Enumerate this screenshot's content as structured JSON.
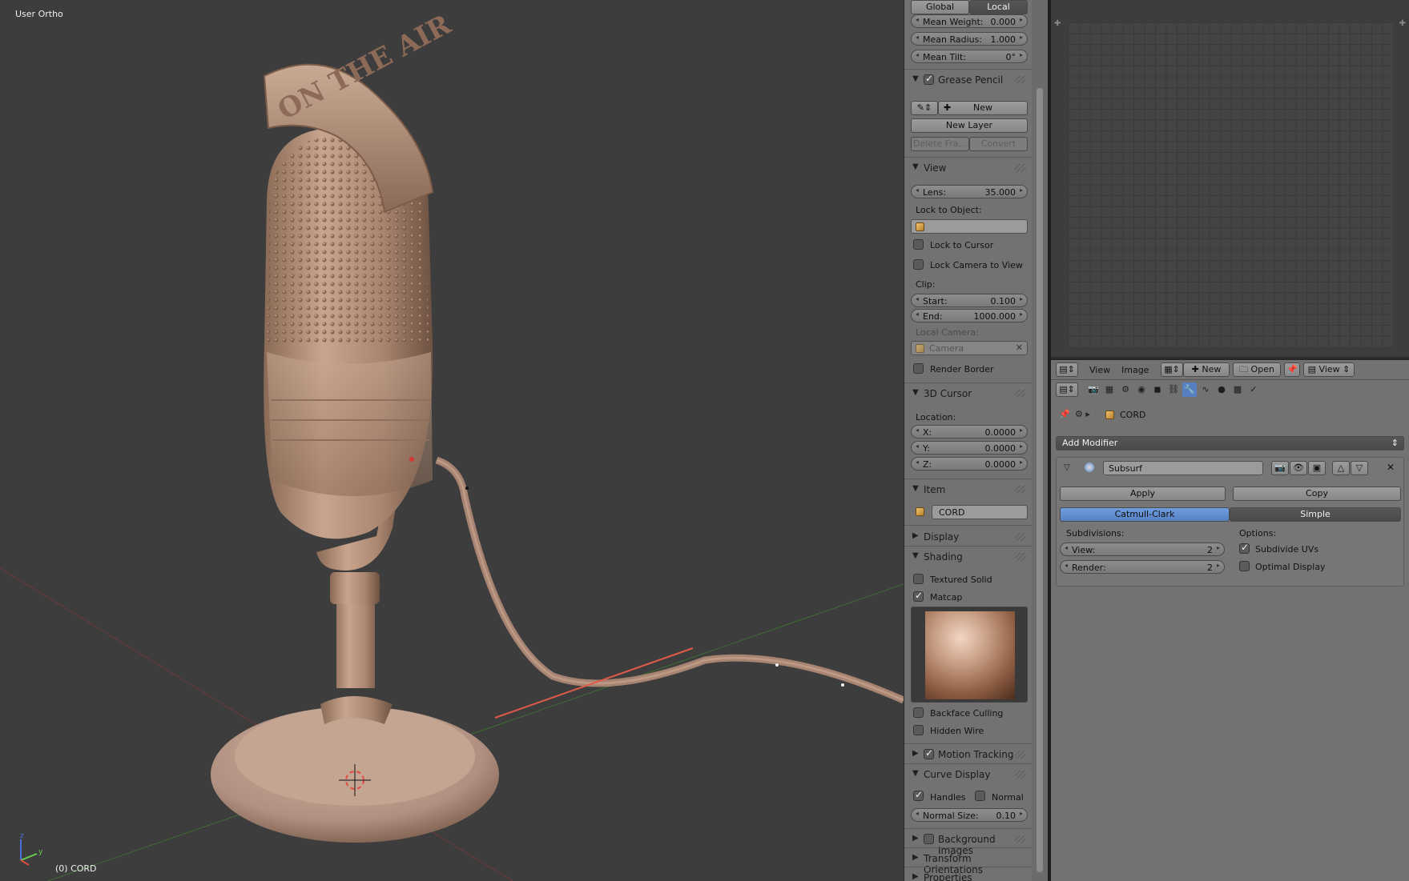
{
  "viewport": {
    "view_label": "User Ortho",
    "object_label": "(0) CORD",
    "overlay_text": "ON THE AIR"
  },
  "npanel": {
    "coord_tabs": [
      "Global",
      "Local"
    ],
    "mean_weight": {
      "label": "Mean Weight:",
      "value": "0.000"
    },
    "mean_radius": {
      "label": "Mean Radius:",
      "value": "1.000"
    },
    "mean_tilt": {
      "label": "Mean Tilt:",
      "value": "0°"
    },
    "grease_pencil": {
      "title": "Grease Pencil",
      "new": "New",
      "new_layer": "New Layer",
      "delete_frame": "Delete Fra...",
      "convert": "Convert"
    },
    "view": {
      "title": "View",
      "lens": {
        "label": "Lens:",
        "value": "35.000"
      },
      "lock_to_object": "Lock to Object:",
      "lock_to_cursor": "Lock to Cursor",
      "lock_camera": "Lock Camera to View",
      "clip": "Clip:",
      "clip_start": {
        "label": "Start:",
        "value": "0.100"
      },
      "clip_end": {
        "label": "End:",
        "value": "1000.000"
      },
      "local_camera": "Local Camera:",
      "camera": "Camera",
      "render_border": "Render Border"
    },
    "cursor": {
      "title": "3D Cursor",
      "location": "Location:",
      "x": {
        "label": "X:",
        "value": "0.0000"
      },
      "y": {
        "label": "Y:",
        "value": "0.0000"
      },
      "z": {
        "label": "Z:",
        "value": "0.0000"
      }
    },
    "item": {
      "title": "Item",
      "name": "CORD"
    },
    "display": {
      "title": "Display"
    },
    "shading": {
      "title": "Shading",
      "textured_solid": "Textured Solid",
      "matcap": "Matcap",
      "backface": "Backface Culling",
      "hidden_wire": "Hidden Wire"
    },
    "motion_tracking": {
      "title": "Motion Tracking"
    },
    "curve_display": {
      "title": "Curve Display",
      "handles": "Handles",
      "normal": "Normal",
      "normal_size": {
        "label": "Normal Size:",
        "value": "0.10"
      }
    },
    "background_images": {
      "title": "Background Images"
    },
    "transform_orientations": {
      "title": "Transform Orientations"
    },
    "properties": {
      "title": "Properties"
    }
  },
  "image_header": {
    "view": "View",
    "image": "Image",
    "new": "New",
    "open": "Open",
    "view2": "View"
  },
  "props": {
    "object_name": "CORD",
    "add_modifier": "Add Modifier",
    "modifier_name": "Subsurf",
    "apply": "Apply",
    "copy": "Copy",
    "catmull": "Catmull-Clark",
    "simple": "Simple",
    "subdivisions": "Subdivisions:",
    "options": "Options:",
    "view": {
      "label": "View:",
      "value": "2"
    },
    "render": {
      "label": "Render:",
      "value": "2"
    },
    "subdivide_uvs": "Subdivide UVs",
    "optimal_display": "Optimal Display"
  }
}
